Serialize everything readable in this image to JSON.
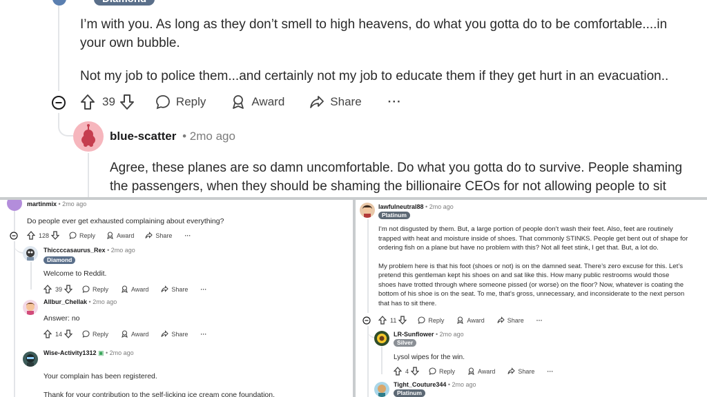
{
  "top": {
    "badge": "Diamond",
    "comment_lines": [
      "I’m with you. As long as they don’t smell to high heavens, do what you gotta do to be comfortable....in",
      "your own bubble.",
      "Not my job to police them...and certainly not my job to educate them if they get hurt in an evacuation.."
    ],
    "votes": "39",
    "reply": "Reply",
    "award": "Award",
    "share": "Share",
    "more": "···",
    "reply_user": "blue-scatter",
    "reply_time": "• 2mo ago",
    "reply_lines": [
      "Agree, these planes are so damn uncomfortable. Do what you gotta do to survive. People shaming",
      "the passengers, when they should be shaming the billionaire CEOs for not allowing people to sit"
    ]
  },
  "left": {
    "c1_user": "martinmix",
    "c1_time": "• 2mo ago",
    "c1_text": "Do people ever get exhausted complaining about everything?",
    "c1_votes": "128",
    "c2_user": "Thiccccasaurus_Rex",
    "c2_time": "• 2mo ago",
    "c2_badge": "Diamond",
    "c2_text": "Welcome to Reddit.",
    "c2_votes": "39",
    "c3_user": "Allbur_Chellak",
    "c3_time": "• 2mo ago",
    "c3_text": "Answer: no",
    "c3_votes": "14",
    "c4_user": "Wise-Activity1312",
    "c4_time": "• 2mo ago",
    "c4_text1": "Your complain has been registered.",
    "c4_text2": "Thank for your contribution to the self-licking ice cream cone foundation.",
    "reply": "Reply",
    "award": "Award",
    "share": "Share",
    "more": "···"
  },
  "right": {
    "c1_user": "lawfulneutral88",
    "c1_time": "• 2mo ago",
    "c1_badge": "Platinum",
    "p1": [
      "I’m not disgusted by them. But, a large portion of people don’t wash their feet. Also, feet are routinely",
      "trapped with heat and moisture inside of shoes. That commonly STINKS. People get bent out of shape for",
      "ordering fish on a plane but have no problem with this? Not all feet stink, I get that. But, a lot do."
    ],
    "p2": [
      "My problem here is that his foot (shoes or not) is on the damned seat. There’s zero excuse for this. Let’s",
      "pretend this gentleman kept his shoes on and sat like this. How many public restrooms would those",
      "shoes have trotted through where someone pissed (or worse) on the floor? Now, whatever is coating the",
      "bottom of his shoe is on the seat. To me, that’s gross, unnecessary, and inconsiderate to the next person",
      "that has to sit there."
    ],
    "c1_votes": "11",
    "c2_user": "LR-Sunflower",
    "c2_time": "• 2mo ago",
    "c2_badge": "Silver",
    "c2_text": "Lysol wipes for the win.",
    "c2_votes": "4",
    "c3_user": "Tight_Couture344",
    "c3_time": "• 2mo ago",
    "c3_badge": "Platinum",
    "reply": "Reply",
    "award": "Award",
    "share": "Share",
    "more": "···"
  },
  "icons": [
    "collapse-icon",
    "upvote-icon",
    "downvote-icon",
    "reply-icon",
    "award-icon",
    "share-icon",
    "more-icon",
    "avatar"
  ]
}
